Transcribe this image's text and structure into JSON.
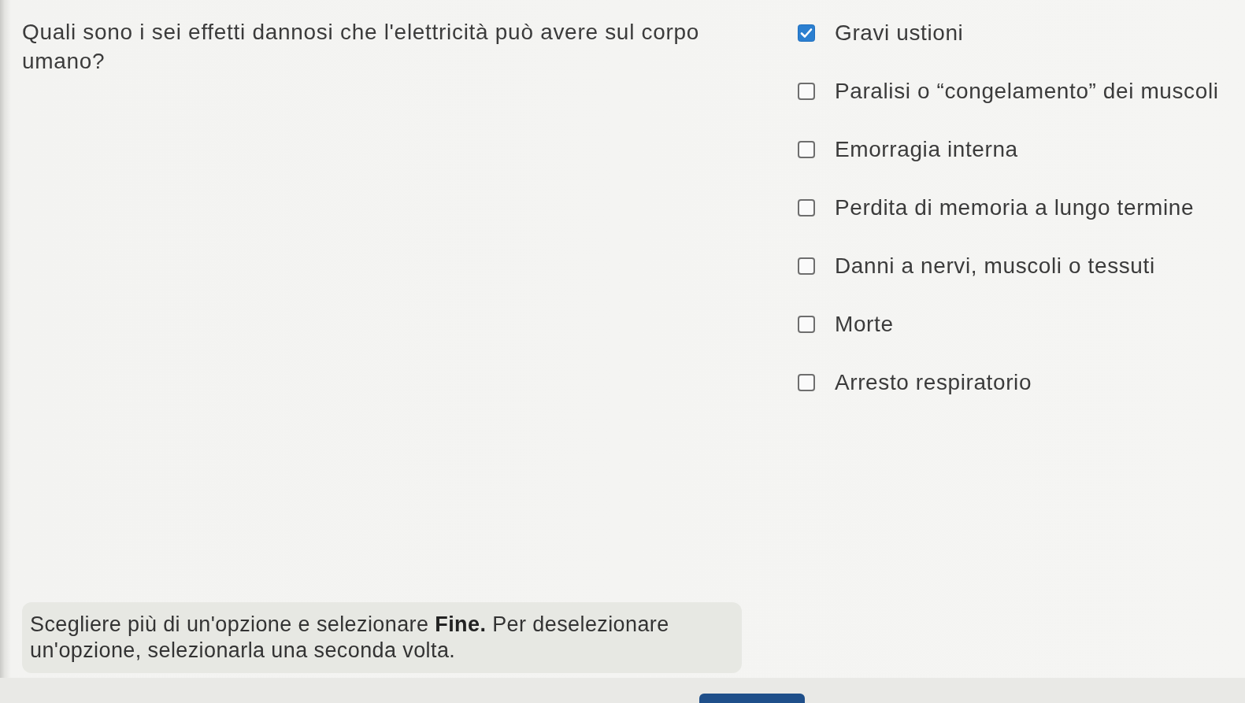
{
  "question": "Quali sono i sei effetti dannosi che l'elettricità può avere sul corpo umano?",
  "options": [
    {
      "label": "Gravi ustioni",
      "checked": true
    },
    {
      "label": "Paralisi o “congelamento” dei muscoli",
      "checked": false
    },
    {
      "label": "Emorragia interna",
      "checked": false
    },
    {
      "label": "Perdita di memoria a lungo termine",
      "checked": false
    },
    {
      "label": "Danni a nervi, muscoli o tessuti",
      "checked": false
    },
    {
      "label": "Morte",
      "checked": false
    },
    {
      "label": "Arresto respiratorio",
      "checked": false
    }
  ],
  "instruction": "Scegliere più di un'opzione e selezionare **Fine.** Per deselezionare un'opzione, selezionarla una seconda volta."
}
